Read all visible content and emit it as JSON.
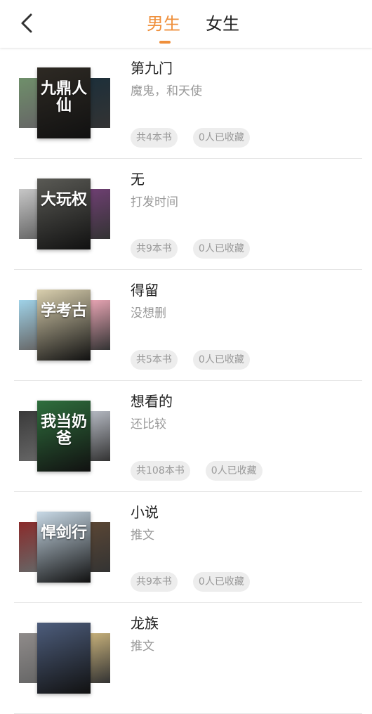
{
  "header": {
    "tabs": [
      {
        "label": "男生",
        "active": true
      },
      {
        "label": "女生",
        "active": false
      }
    ],
    "accent_color": "#ef8f3b"
  },
  "lists": [
    {
      "title": "第九门",
      "desc": "魔鬼，和天使",
      "count": "共4本书",
      "saved": "0人已收藏",
      "cover_text": "九鼎人仙",
      "colors": [
        "#2e2a24",
        "#6f8f6a",
        "#1d2f3a"
      ]
    },
    {
      "title": "无",
      "desc": "打发时间",
      "count": "共9本书",
      "saved": "0人已收藏",
      "cover_text": "大玩权",
      "colors": [
        "#5a5a55",
        "#c7c7c7",
        "#6e3f72"
      ]
    },
    {
      "title": "得留",
      "desc": "没想删",
      "count": "共5本书",
      "saved": "0人已收藏",
      "cover_text": "学考古",
      "colors": [
        "#d9cfae",
        "#9fd2e8",
        "#e7a4b3"
      ]
    },
    {
      "title": "想看的",
      "desc": "还比较",
      "count": "共108本书",
      "saved": "0人已收藏",
      "cover_text": "我当奶爸",
      "colors": [
        "#2f6f3d",
        "#3a3a3a",
        "#b5b9c2"
      ]
    },
    {
      "title": "小说",
      "desc": "推文",
      "count": "共9本书",
      "saved": "0人已收藏",
      "cover_text": "悍剑行",
      "colors": [
        "#c8d9e6",
        "#8a2b2b",
        "#5a4634"
      ]
    },
    {
      "title": "龙族",
      "desc": "推文",
      "count": "",
      "saved": "",
      "cover_text": "",
      "colors": [
        "#4d5d7c",
        "#8f8b8a",
        "#c6b07a"
      ]
    }
  ]
}
